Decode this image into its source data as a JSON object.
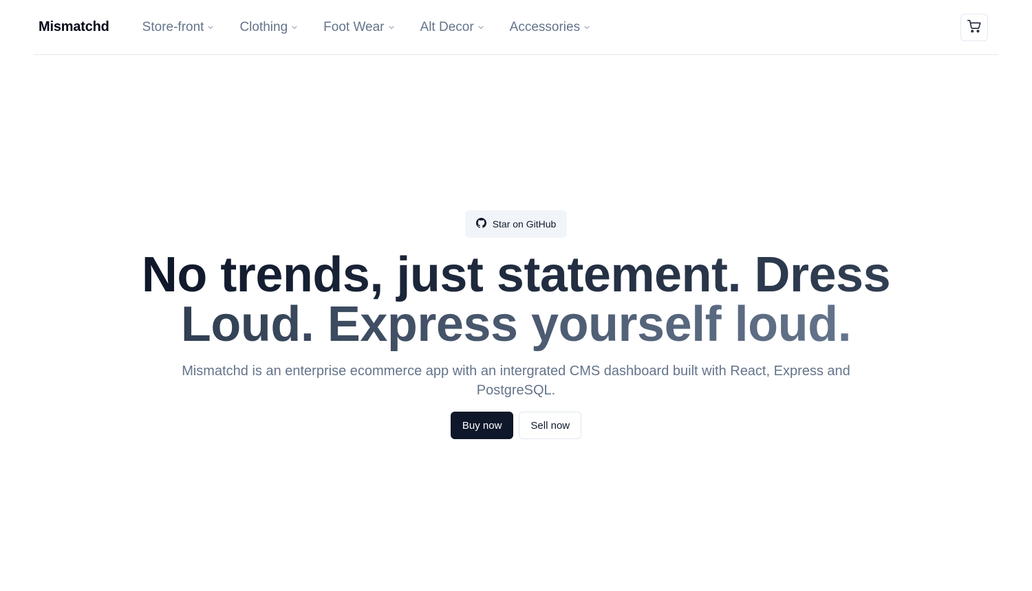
{
  "header": {
    "brand": "Mismatchd",
    "nav": [
      {
        "label": "Store-front"
      },
      {
        "label": "Clothing"
      },
      {
        "label": "Foot Wear"
      },
      {
        "label": "Alt Decor"
      },
      {
        "label": "Accessories"
      }
    ],
    "cart_icon": "shopping-cart-icon"
  },
  "hero": {
    "badge_icon": "github-icon",
    "badge_label": "Star on GitHub",
    "headline": "No trends, just statement. Dress Loud. Express yourself loud.",
    "subtitle": "Mismatchd is an enterprise ecommerce app with an intergrated CMS dashboard built with React, Express and PostgreSQL.",
    "buy_label": "Buy now",
    "sell_label": "Sell now"
  },
  "colors": {
    "primary": "#0f172a",
    "muted_text": "#64748b",
    "border": "#e2e8f0",
    "badge_bg": "#f1f5f9"
  }
}
